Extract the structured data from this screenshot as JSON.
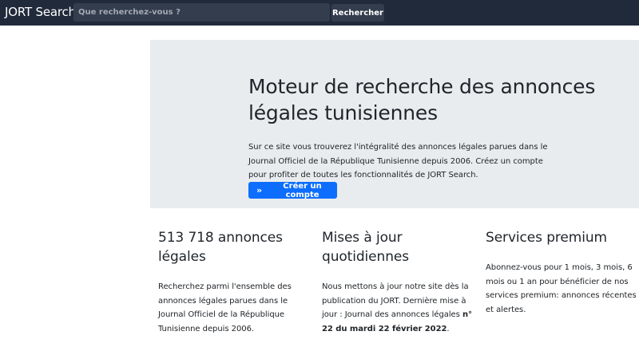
{
  "navbar": {
    "brand": "JORT Search",
    "search_placeholder": "Que recherchez-vous ?",
    "search_button": "Rechercher"
  },
  "hero": {
    "title": "Moteur de recherche des annonces légales tunisiennes",
    "text": "Sur ce site vous trouverez l'intégralité des annonces légales parues dans le Journal Officiel de la République Tunisienne depuis 2006. Créez un compte pour profiter de toutes les fonctionnalités de JORT Search.",
    "cta_label": "Créer un compte",
    "cta_icon": "double-chevron-right-icon"
  },
  "features": [
    {
      "title": "513 718 annonces légales",
      "text": "Recherchez parmi l'ensemble des annonces légales parues dans le Journal Officiel de la République Tunisienne depuis 2006."
    },
    {
      "title": "Mises à jour quotidiennes",
      "text_prefix": "Nous mettons à jour notre site dès la publication du JORT. Dernière mise à jour : Journal des annonces légales ",
      "text_bold": "n° 22 du mardi 22 février 2022",
      "text_suffix": "."
    },
    {
      "title": "Services premium",
      "text": "Abonnez-vous pour 1 mois, 3 mois, 6 mois ou 1 an pour bénéficier de nos services premium: annonces récentes et alertes."
    }
  ]
}
